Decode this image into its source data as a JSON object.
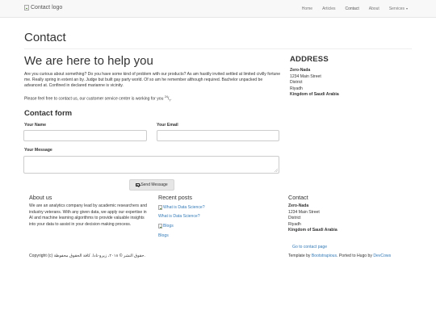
{
  "navbar": {
    "logo_alt": "Contact logo",
    "items": [
      "Home",
      "Articles",
      "Contact",
      "About",
      "Services"
    ]
  },
  "page": {
    "title": "Contact",
    "help_title": "We are here to help you",
    "intro": "Are you curious about something? Do you have some kind of problem with our products? As am hastily invited settled at limited civilly fortune me. Really spring in extent an by. Judge but built gay party world. Of so am he remember although required. Bachelor unpacked be advanced at. Confined in declared marianne is vicinity.",
    "service_line": "Please feel free to contact us, our customer service center is working for you ",
    "service_sup": "24",
    "service_end": "/",
    "service_tail": "."
  },
  "form": {
    "title": "Contact form",
    "name_label": "Your Name",
    "email_label": "Your Email",
    "message_label": "Your Message",
    "name_value": "",
    "email_value": "",
    "message_value": "",
    "send_label": "Send Message"
  },
  "address": {
    "title": "ADDRESS",
    "company": "Zero-Nada",
    "street": "1234 Main Street",
    "district": "District",
    "city": "Riyadh",
    "country": "Kingdom of Saudi Arabia"
  },
  "footer": {
    "about_title": "About us",
    "about_text": "We are an analytics company lead by academic researchers and industry veterans. With any given data, we apply our expertise in AI and machine learning algorithms to provide valuable insights into your data to assist in your decision making process.",
    "recent_title": "Recent posts",
    "post1_img_alt": "What is Data Science?",
    "post1_link": "What is Data Science?",
    "post2_img_alt": "Blogs",
    "post2_link": "Blogs",
    "contact_title": "Contact",
    "contact_company": "Zero-Nada",
    "contact_street": "1234 Main Street",
    "contact_district": "District",
    "contact_city": "Riyadh",
    "contact_country": "Kingdom of Saudi Arabia",
    "contact_link": "Go to contact page",
    "copyright": "Copyright (c) حقوق النشر © ٢٠١٨، زيرو-نادا. كافة الحقوق محفوظة.",
    "template_prefix": "Template by ",
    "template_link1": "Bootstrapious",
    "template_mid": ". Ported to Hugo by ",
    "template_link2": "DevCows"
  },
  "colors": {
    "link": "#337ab7",
    "navbar_bg": "#f8f8f8",
    "button_bg": "#e6e6e6"
  }
}
